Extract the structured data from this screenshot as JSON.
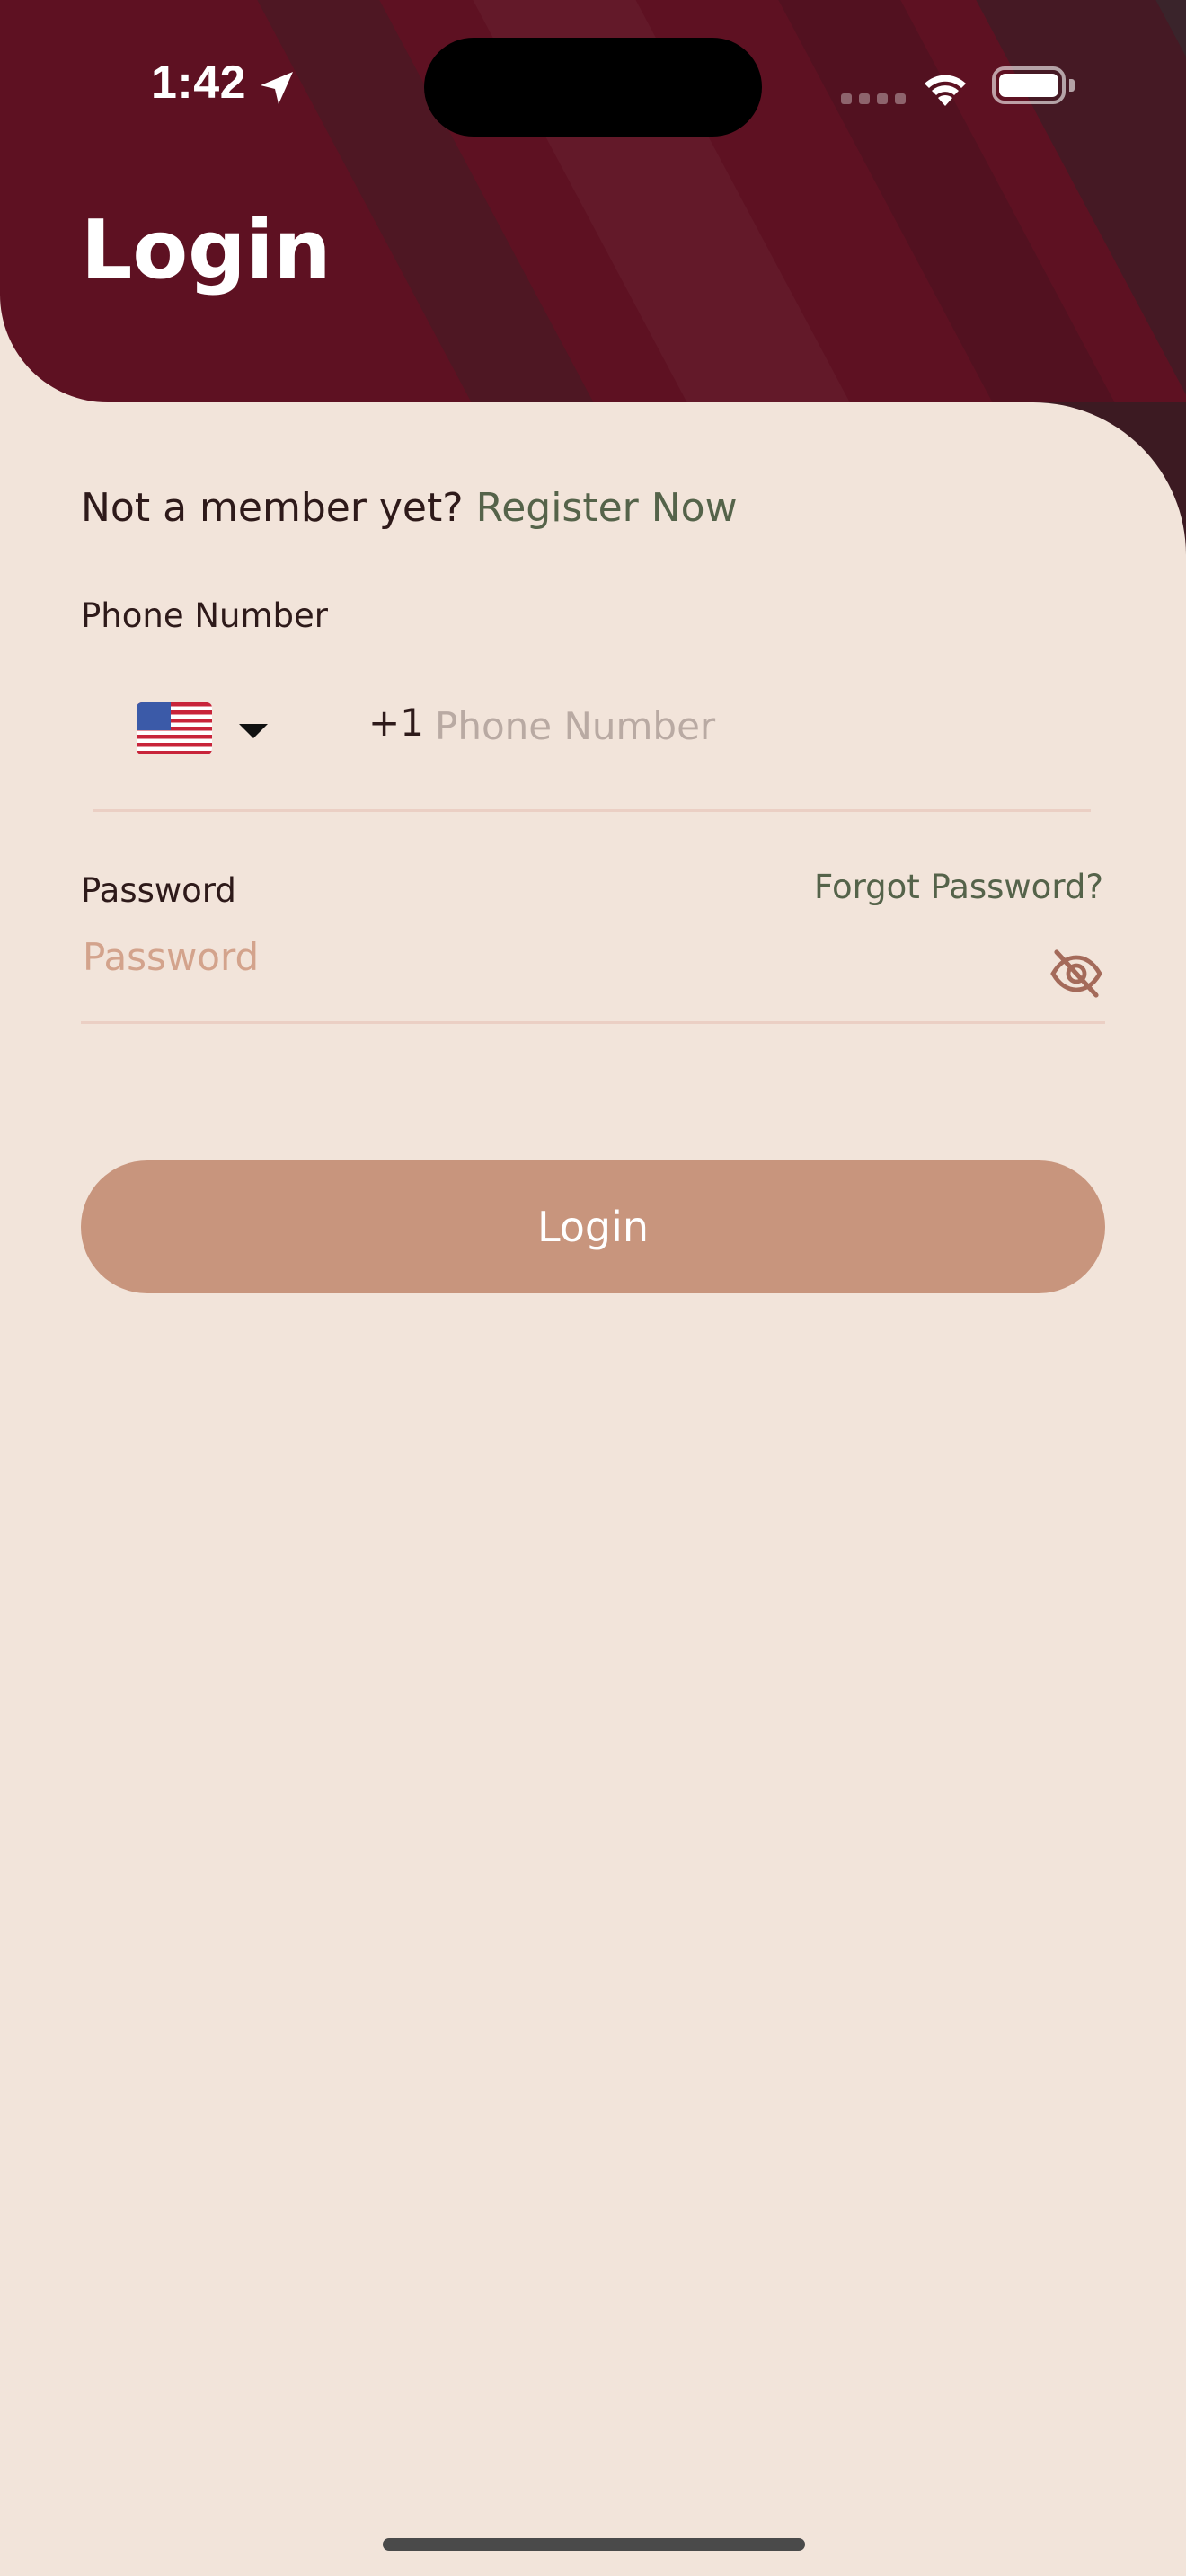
{
  "status_bar": {
    "time": "1:42"
  },
  "header": {
    "title": "Login"
  },
  "register": {
    "prompt": "Not a member yet?",
    "link": "Register Now"
  },
  "phone": {
    "label": "Phone Number",
    "country_flag": "us-flag-icon",
    "dial_code": "+1",
    "placeholder": "Phone Number",
    "value": ""
  },
  "password": {
    "label": "Password",
    "forgot": "Forgot Password?",
    "placeholder": "Password",
    "value": ""
  },
  "login_button": {
    "label": "Login"
  },
  "colors": {
    "header_bg": "#5e1122",
    "page_bg": "#f2e4da",
    "accent_link": "#55634a",
    "button_bg": "#c8957d"
  }
}
